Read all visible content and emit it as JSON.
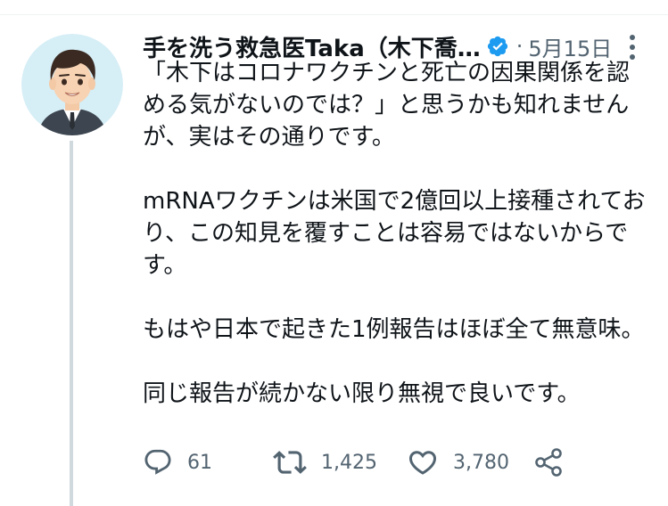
{
  "tweet": {
    "author": {
      "display_name": "手を洗う救急医Taka（木下喬…",
      "verified": true
    },
    "separator": "·",
    "date": "5月15日",
    "paragraphs": [
      "「木下はコロナワクチンと死亡の因果関係を認める気がないのでは？」と思うかも知れませんが、実はその通りです。",
      "mRNAワクチンは米国で2億回以上接種されており、この知見を覆すことは容易ではないからです。",
      "もはや日本で起きた1例報告はほぼ全て無意味。",
      "同じ報告が続かない限り無視で良いです。"
    ],
    "actions": {
      "reply_count": "61",
      "retweet_count": "1,425",
      "like_count": "3,780"
    }
  },
  "icons": {
    "reply": "reply-icon",
    "retweet": "retweet-icon",
    "like": "heart-icon",
    "share": "share-icon",
    "more": "more-vertical-icon",
    "verified": "verified-badge-icon"
  },
  "colors": {
    "text": "#0f1419",
    "secondary_text": "#536471",
    "verified_blue": "#1d9bf0",
    "thread_line": "#cfd9de"
  }
}
